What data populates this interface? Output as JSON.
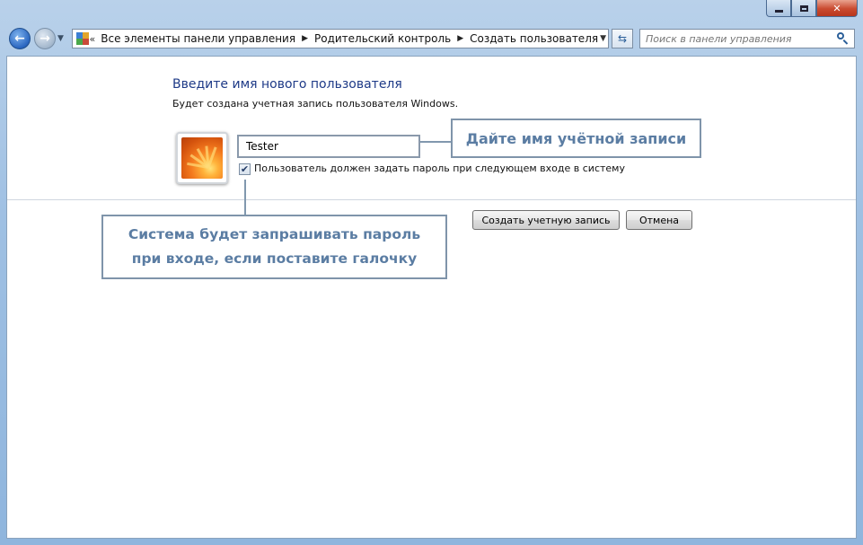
{
  "address_bar": {
    "lead": "«",
    "crumbs": [
      "Все элементы панели управления",
      "Родительский контроль",
      "Создать пользователя"
    ],
    "separator": "▶"
  },
  "search": {
    "placeholder": "Поиск в панели управления"
  },
  "content": {
    "title": "Введите имя нового пользователя",
    "subtitle": "Будет создана учетная запись пользователя Windows.",
    "username_value": "Tester",
    "password_checkbox": {
      "checked": true,
      "label": "Пользователь должен задать пароль при следующем входе в систему"
    },
    "create_button": "Создать учетную запись",
    "cancel_button": "Отмена"
  },
  "callouts": {
    "name": "Дайте имя учётной записи",
    "password_line1": "Система будет запрашивать пароль",
    "password_line2": "при входе, если поставите галочку"
  },
  "colors": {
    "title": "#1e3a87",
    "callout_text": "#5b7da3",
    "callout_border": "#7f94aa"
  }
}
